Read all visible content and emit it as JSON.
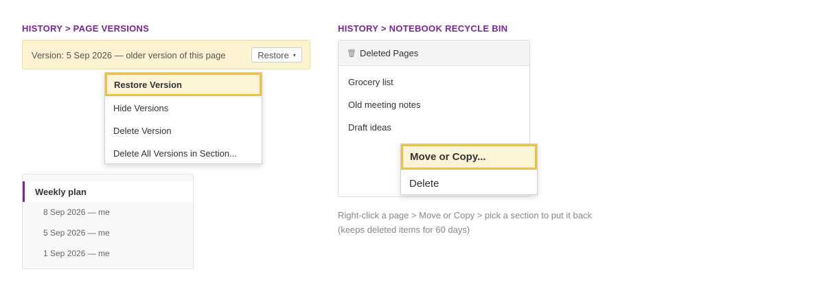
{
  "left": {
    "heading": "HISTORY > PAGE VERSIONS",
    "banner": {
      "text": "Version: 5 Sep 2026 — older version of this page",
      "restore_label": "Restore",
      "caret": "▾"
    },
    "menu": {
      "items": [
        "Restore Version",
        "Hide Versions",
        "Delete Version",
        "Delete All Versions in Section..."
      ]
    },
    "versions": {
      "title": "Weekly plan",
      "rows": [
        "8 Sep 2026 — me",
        "5 Sep 2026 — me",
        "1 Sep 2026 — me"
      ]
    }
  },
  "right": {
    "heading": "HISTORY > NOTEBOOK RECYCLE BIN",
    "panel": {
      "title": "Deleted Pages",
      "icon": "trash-icon",
      "icon_glyph": "🗑",
      "items": [
        "Grocery list",
        "Old meeting notes",
        "Draft ideas"
      ]
    },
    "menu": {
      "items": [
        "Move or Copy...",
        "Delete"
      ]
    },
    "note": {
      "line1": "Right-click a page > Move or Copy > pick a section to put it back",
      "line2": "(keeps deleted items for 60 days)"
    }
  },
  "colors": {
    "accent": "#7a2596",
    "highlight_border": "#f0c040",
    "highlight_fill": "#fdf4d8",
    "banner_fill": "#fdf3d0"
  }
}
